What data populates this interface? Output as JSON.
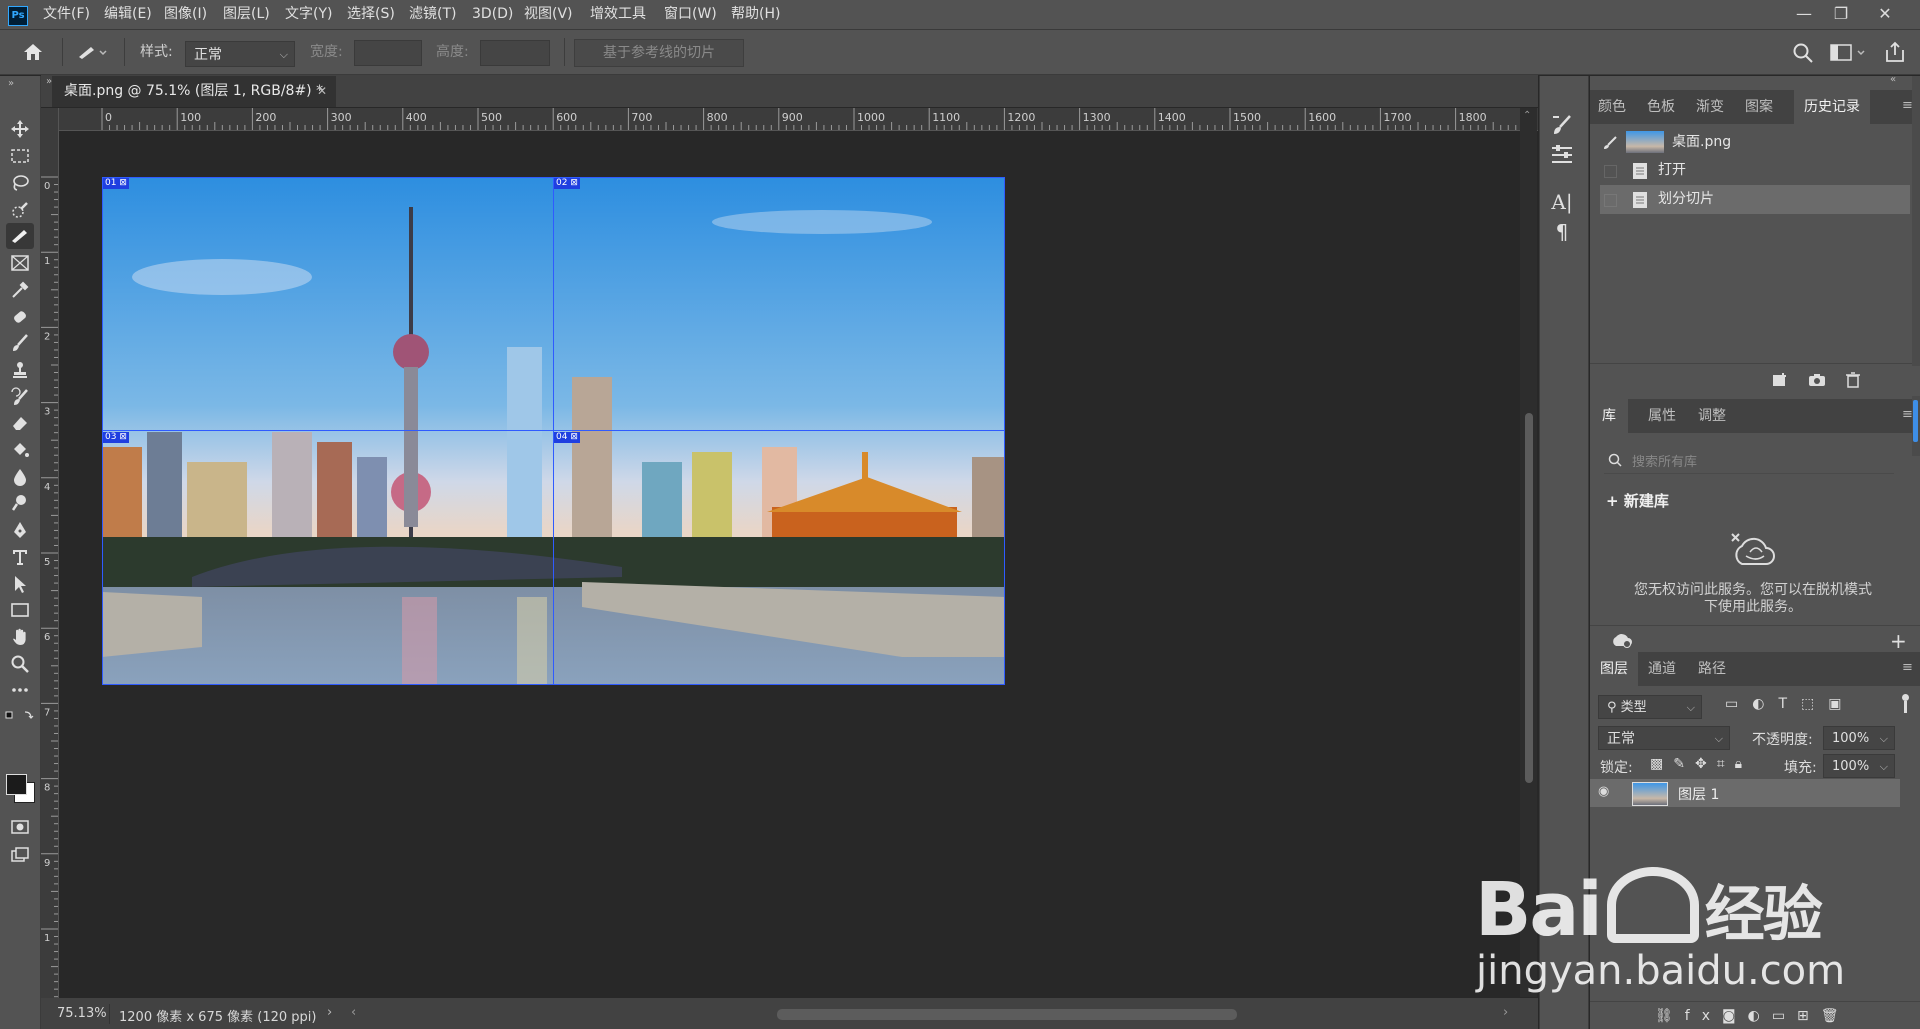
{
  "app": {
    "logo": "Ps"
  },
  "menu": [
    "文件(F)",
    "编辑(E)",
    "图像(I)",
    "图层(L)",
    "文字(Y)",
    "选择(S)",
    "滤镜(T)",
    "3D(D)",
    "视图(V)",
    "增效工具",
    "窗口(W)",
    "帮助(H)"
  ],
  "options": {
    "style_label": "样式:",
    "style_value": "正常",
    "width_label": "宽度:",
    "height_label": "高度:",
    "guides_button": "基于参考线的切片"
  },
  "document": {
    "tab_title": "桌面.png @ 75.1% (图层 1, RGB/8#) *",
    "zoom": "75.13%",
    "size": "1200 像素 x 675 像素 (120 ppi)"
  },
  "ruler": {
    "h": [
      "0",
      "100",
      "200",
      "300",
      "400",
      "500",
      "600",
      "700",
      "800",
      "900",
      "1000",
      "1100",
      "1200",
      "1300",
      "1400",
      "1500",
      "1600",
      "1700",
      "1800"
    ],
    "v": [
      "0",
      "1",
      "2",
      "3",
      "4",
      "5",
      "6",
      "7",
      "8",
      "9",
      "1"
    ]
  },
  "slices": [
    "01",
    "02",
    "03",
    "04"
  ],
  "history_panel": {
    "tabs": [
      "颜色",
      "色板",
      "渐变",
      "图案",
      "历史记录"
    ],
    "snapshot": "桌面.png",
    "states": [
      "打开",
      "划分切片"
    ]
  },
  "library_panel": {
    "tabs": [
      "库",
      "属性",
      "调整"
    ],
    "search_placeholder": "搜索所有库",
    "new_library": "新建库",
    "message": "您无权访问此服务。您可以在脱机模式下使用此服务。"
  },
  "layers_panel": {
    "tabs": [
      "图层",
      "通道",
      "路径"
    ],
    "filter": "类型",
    "blend_mode": "正常",
    "opacity_label": "不透明度:",
    "opacity": "100%",
    "lock_label": "锁定:",
    "fill_label": "填充:",
    "fill": "100%",
    "layer_name": "图层 1"
  },
  "watermark": {
    "brand": "Bai",
    "brand2": "经验",
    "url": "jingyan.baidu.com"
  },
  "colors": {
    "slice_line": "#2f5bff",
    "ui_bg": "#535353",
    "canvas_bg": "#282828"
  }
}
